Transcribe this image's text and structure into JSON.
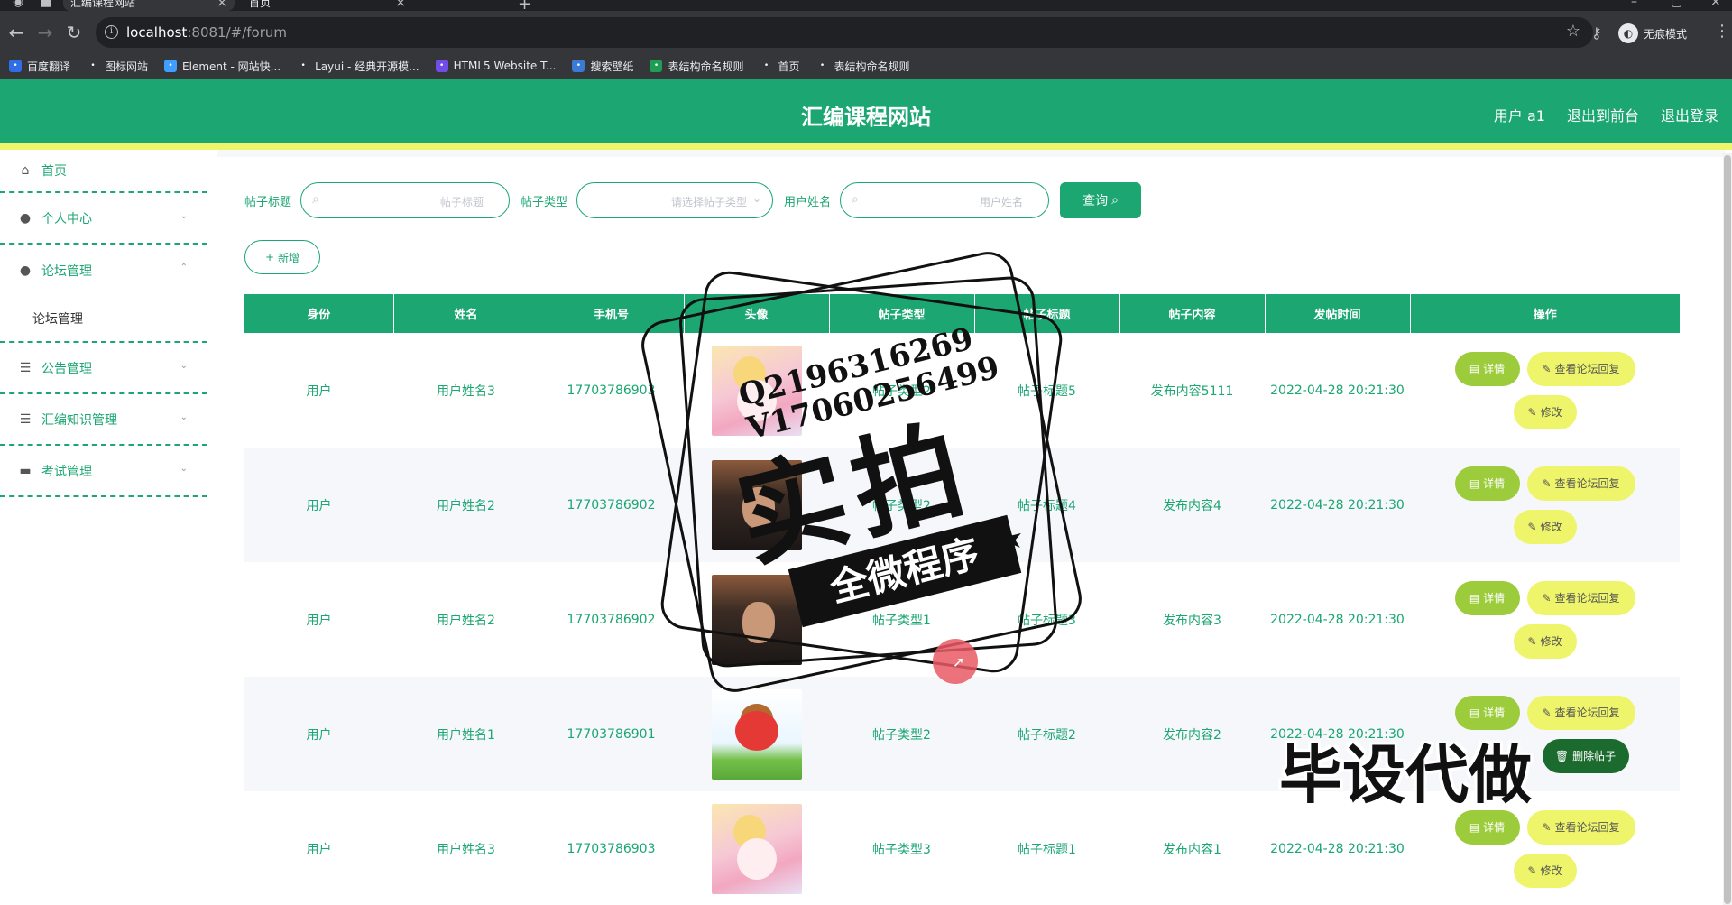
{
  "browser": {
    "tabs": [
      {
        "label": "汇编课程网站",
        "active": true
      },
      {
        "label": "首页",
        "active": false
      }
    ],
    "url_host": "localhost",
    "url_path": ":8081/#/forum",
    "profile_label": "无痕模式",
    "bookmarks": [
      {
        "label": "百度翻译",
        "icon": "baidu-translate-icon",
        "color": "#2f6ee6"
      },
      {
        "label": "图标网站",
        "icon": "flag-icon",
        "color": "#35363a"
      },
      {
        "label": "Element - 网站快...",
        "icon": "element-icon",
        "color": "#409eff"
      },
      {
        "label": "Layui - 经典开源模...",
        "icon": "layui-icon",
        "color": "#35363a"
      },
      {
        "label": "HTML5 Website T...",
        "icon": "html5-icon",
        "color": "#6e4de8"
      },
      {
        "label": "搜索壁纸",
        "icon": "wallpaper-icon",
        "color": "#3a7bd5"
      },
      {
        "label": "表结构命名规则",
        "icon": "sheet-icon",
        "color": "#1f9d55"
      },
      {
        "label": "首页",
        "icon": "globe-icon",
        "color": "#35363a"
      },
      {
        "label": "表结构命名规则",
        "icon": "globe-icon",
        "color": "#35363a"
      }
    ]
  },
  "header": {
    "title": "汇编课程网站",
    "links": [
      "用户 a1",
      "退出到前台",
      "退出登录"
    ]
  },
  "sidebar": {
    "items": [
      {
        "label": "首页",
        "icon": "home-icon",
        "expandable": false
      },
      {
        "label": "个人中心",
        "icon": "user-icon",
        "expandable": true
      },
      {
        "label": "论坛管理",
        "icon": "user-icon",
        "expandable": true,
        "open": true,
        "children": [
          "论坛管理"
        ]
      },
      {
        "label": "公告管理",
        "icon": "list-icon",
        "expandable": true
      },
      {
        "label": "汇编知识管理",
        "icon": "list-icon",
        "expandable": true
      },
      {
        "label": "考试管理",
        "icon": "exam-icon",
        "expandable": true
      }
    ]
  },
  "filters": {
    "title_label": "帖子标题",
    "title_placeholder": "帖子标题",
    "type_label": "帖子类型",
    "type_placeholder": "请选择帖子类型",
    "user_label": "用户姓名",
    "user_placeholder": "用户姓名",
    "query_label": "查询"
  },
  "actions": {
    "add_label": "新增"
  },
  "table": {
    "columns": [
      "身份",
      "姓名",
      "手机号",
      "头像",
      "帖子类型",
      "帖子标题",
      "帖子内容",
      "发帖时间",
      "操作"
    ],
    "op_labels": {
      "detail": "详情",
      "reply": "查看论坛回复",
      "edit": "修改",
      "delete": "删除帖子"
    },
    "rows": [
      {
        "identity": "用户",
        "name": "用户姓名3",
        "phone": "17703786903",
        "avatar": "anime",
        "type": "帖子类型2",
        "title": "帖子标题5",
        "content": "发布内容5111",
        "time": "2022-04-28 20:21:30"
      },
      {
        "identity": "用户",
        "name": "用户姓名2",
        "phone": "17703786902",
        "avatar": "man",
        "type": "帖子类型2",
        "title": "帖子标题4",
        "content": "发布内容4",
        "time": "2022-04-28 20:21:30"
      },
      {
        "identity": "用户",
        "name": "用户姓名2",
        "phone": "17703786902",
        "avatar": "man",
        "type": "帖子类型1",
        "title": "帖子标题3",
        "content": "发布内容3",
        "time": "2022-04-28 20:21:30"
      },
      {
        "identity": "用户",
        "name": "用户姓名1",
        "phone": "17703786901",
        "avatar": "cartoon",
        "type": "帖子类型2",
        "title": "帖子标题2",
        "content": "发布内容2",
        "time": "2022-04-28 20:21:30"
      },
      {
        "identity": "用户",
        "name": "用户姓名3",
        "phone": "17703786903",
        "avatar": "anime",
        "type": "帖子类型3",
        "title": "帖子标题1",
        "content": "发布内容1",
        "time": "2022-04-28 20:21:30"
      }
    ]
  },
  "overlay": {
    "contact_q": "Q2196316269",
    "contact_v": "V17060256499",
    "stamp_big": "实拍",
    "stamp_ribbon": "全微程序",
    "banner": "毕设代做"
  },
  "colors": {
    "primary": "#1ba672",
    "accent_yellow": "#eef56a",
    "detail_green": "#9ccc3b",
    "delete_dark": "#1b6b2f"
  }
}
